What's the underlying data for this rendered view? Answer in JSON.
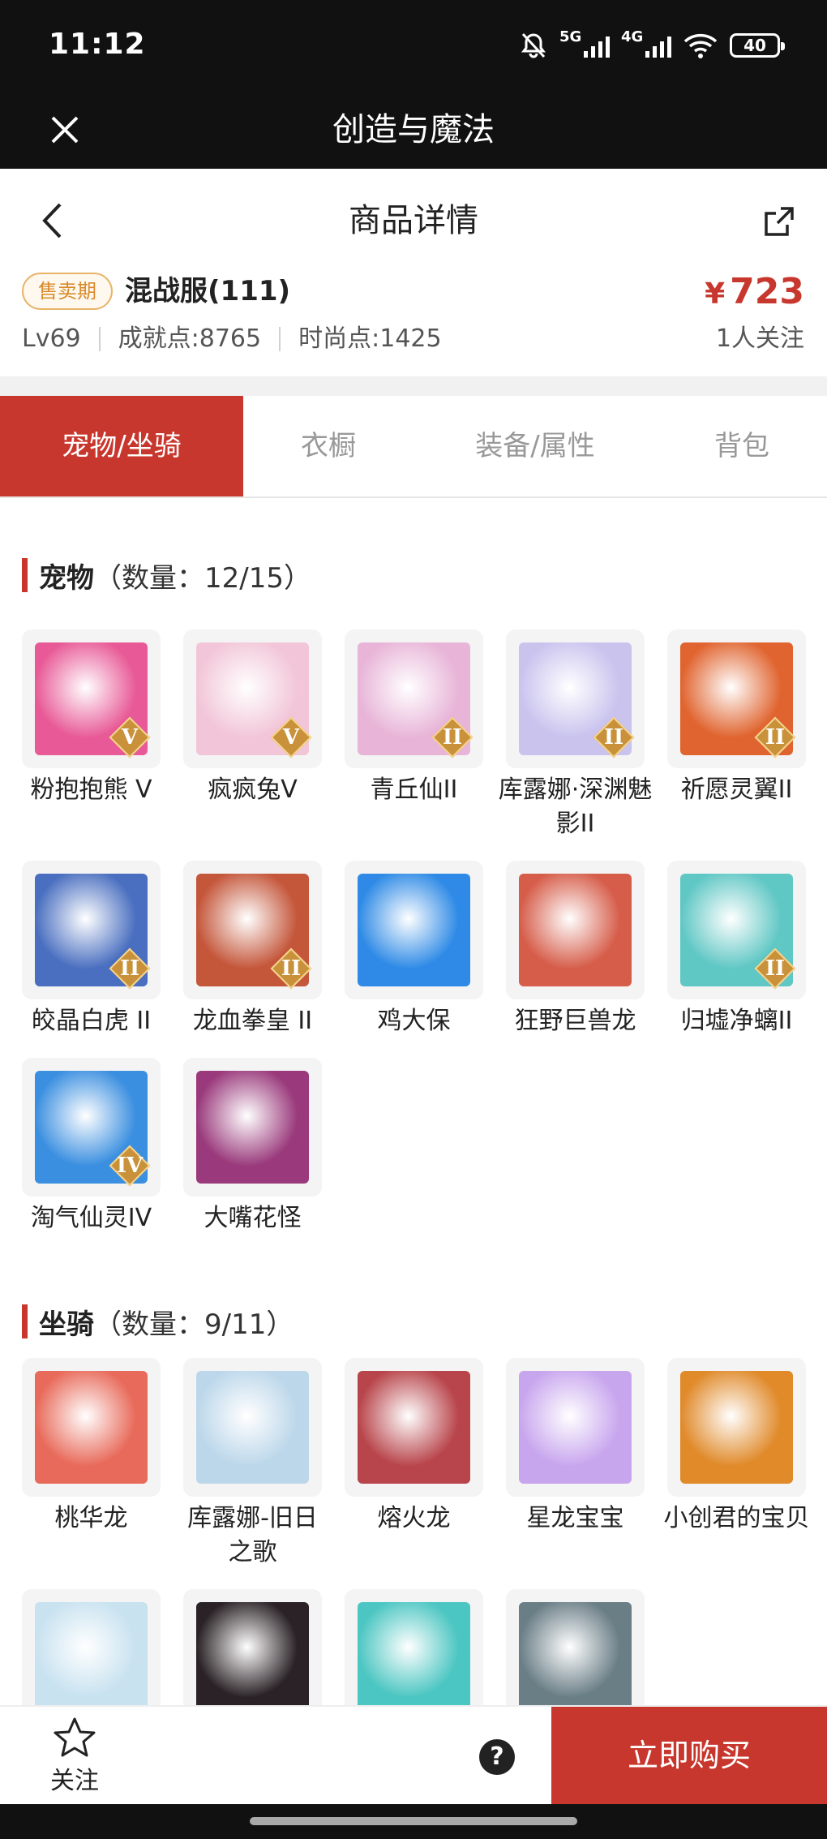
{
  "status_bar": {
    "time": "11:12",
    "signal_1": "5G",
    "signal_2": "4G",
    "battery": "40"
  },
  "app_bar": {
    "title": "创造与魔法"
  },
  "nav": {
    "title": "商品详情"
  },
  "summary": {
    "badge": "售卖期",
    "account_name": "混战服(111)",
    "price_currency": "¥",
    "price_value": "723",
    "level": "Lv69",
    "achievement": "成就点:8765",
    "fashion": "时尚点:1425",
    "followers": "1人关注"
  },
  "tabs": [
    {
      "label": "宠物/坐骑",
      "active": true
    },
    {
      "label": "衣橱",
      "active": false
    },
    {
      "label": "装备/属性",
      "active": false
    },
    {
      "label": "背包",
      "active": false
    }
  ],
  "pets_section": {
    "title": "宠物",
    "count": "（数量：12/15）",
    "items": [
      {
        "name": "粉抱抱熊 V",
        "rank": "V",
        "color": "#e85a97"
      },
      {
        "name": "疯疯兔V",
        "rank": "V",
        "color": "#f2c6d8"
      },
      {
        "name": "青丘仙II",
        "rank": "II",
        "color": "#e8b5d8"
      },
      {
        "name": "库露娜·深渊魅影II",
        "rank": "II",
        "color": "#c9c3ee"
      },
      {
        "name": "祈愿灵翼II",
        "rank": "II",
        "color": "#e0642f"
      },
      {
        "name": "皎晶白虎 II",
        "rank": "II",
        "color": "#4a6fc0"
      },
      {
        "name": "龙血拳皇 II",
        "rank": "II",
        "color": "#c4563a"
      },
      {
        "name": "鸡大保",
        "rank": "",
        "color": "#2e8ae6"
      },
      {
        "name": "狂野巨兽龙",
        "rank": "",
        "color": "#d65d4a"
      },
      {
        "name": "归墟净螭II",
        "rank": "II",
        "color": "#5fc7c4"
      },
      {
        "name": "淘气仙灵IV",
        "rank": "IV",
        "color": "#3b8fe0"
      },
      {
        "name": "大嘴花怪",
        "rank": "",
        "color": "#9a3a7c"
      }
    ]
  },
  "mounts_section": {
    "title": "坐骑",
    "count": "（数量：9/11）",
    "items": [
      {
        "name": "桃华龙",
        "color": "#e86a5a"
      },
      {
        "name": "库露娜-旧日之歌",
        "color": "#bcd7ea"
      },
      {
        "name": "熔火龙",
        "color": "#b8454b"
      },
      {
        "name": "星龙宝宝",
        "color": "#c8a6ee"
      },
      {
        "name": "小创君的宝贝",
        "color": "#e08a2a"
      },
      {
        "name": "",
        "color": "#c8e2f0"
      },
      {
        "name": "",
        "color": "#2a2226"
      },
      {
        "name": "",
        "color": "#4cc6c2"
      },
      {
        "name": "",
        "color": "#6a7e86"
      }
    ]
  },
  "bottom_bar": {
    "favorite_label": "关注",
    "help_symbol": "?",
    "buy_label": "立即购买"
  },
  "colors": {
    "primary": "#c8372d",
    "badge_text": "#d98a2a",
    "dark_bar": "#111111"
  }
}
